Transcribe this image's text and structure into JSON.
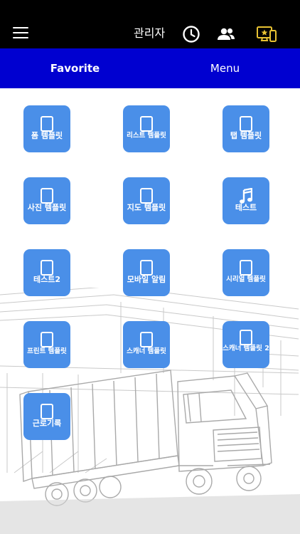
{
  "header": {
    "user_name": "관리자",
    "menu_icon": "hamburger-menu-icon",
    "history_icon": "clock-icon",
    "users_icon": "people-icon",
    "favorite_screen_icon": "device-star-icon",
    "accent_color": "#e8c233"
  },
  "tabs": [
    {
      "label": "Favorite",
      "active": true
    },
    {
      "label": "Menu",
      "active": false
    }
  ],
  "tiles": [
    {
      "label": "폼 템플릿",
      "icon": "tablet-icon"
    },
    {
      "label": "리스트 템플릿",
      "icon": "tablet-icon"
    },
    {
      "label": "탭 템플릿",
      "icon": "tablet-icon"
    },
    {
      "label": "사진 템플릿",
      "icon": "tablet-icon"
    },
    {
      "label": "지도 템플릿",
      "icon": "tablet-icon"
    },
    {
      "label": "테스트",
      "icon": "music-note-icon"
    },
    {
      "label": "테스트2",
      "icon": "tablet-icon"
    },
    {
      "label": "모바일 알림",
      "icon": "tablet-icon"
    },
    {
      "label": "시리얼 템플릿",
      "icon": "tablet-icon"
    },
    {
      "label": "프린트 템플릿",
      "icon": "tablet-icon"
    },
    {
      "label": "스캐너 템플릿",
      "icon": "tablet-icon"
    },
    {
      "label": "스캐너 템플릿 2",
      "icon": "tablet-icon"
    },
    {
      "label": "근로기록",
      "icon": "tablet-icon"
    }
  ],
  "colors": {
    "header_bg": "#000000",
    "tab_bar_bg": "#0000d0",
    "tile_bg": "#4a8fe8"
  }
}
